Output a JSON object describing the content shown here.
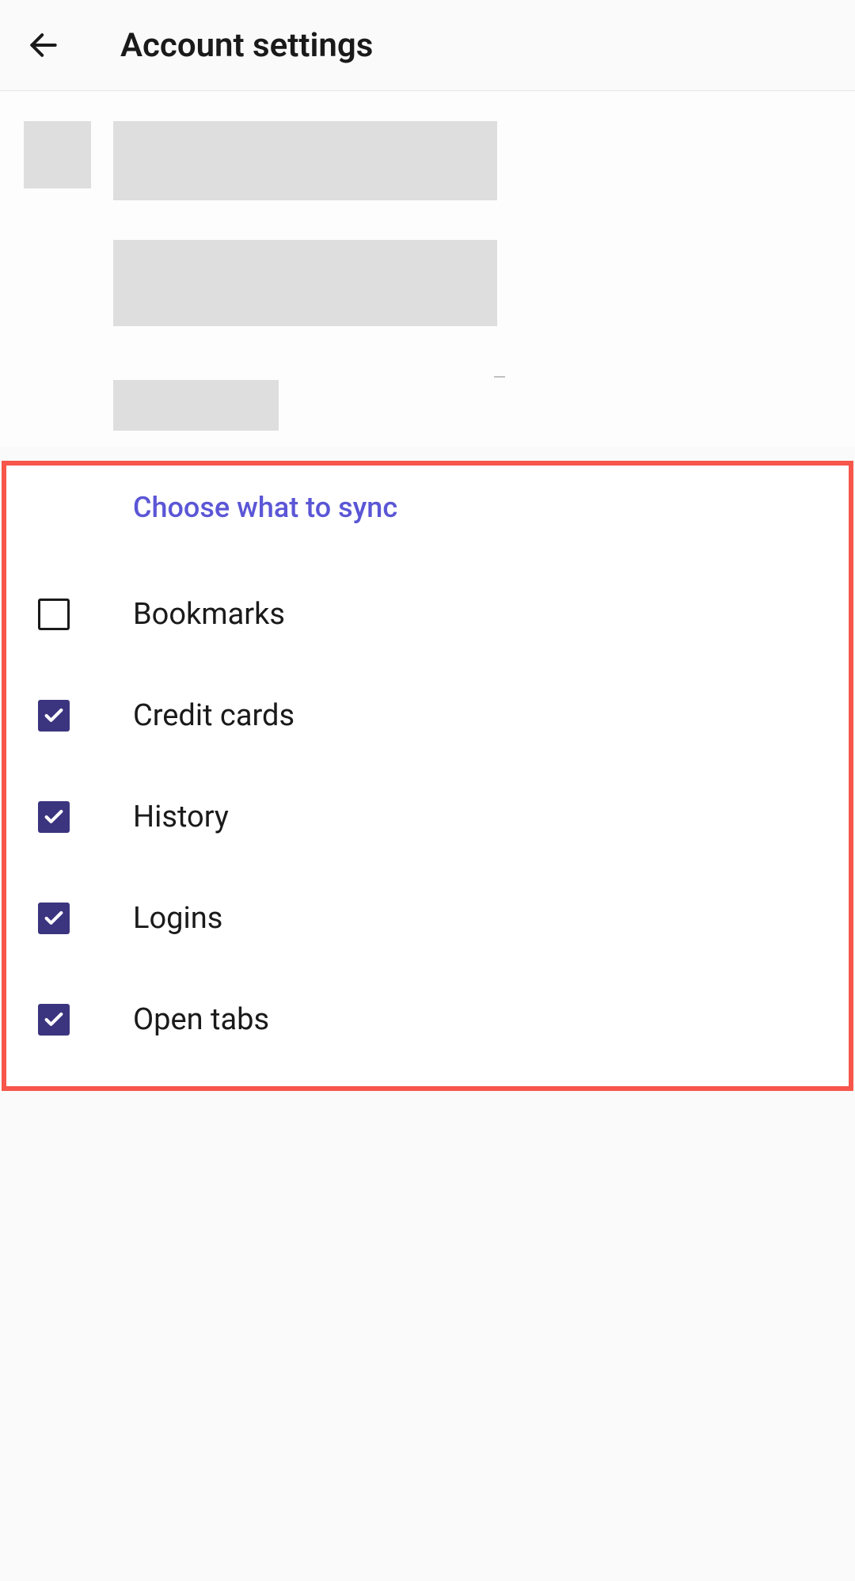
{
  "header": {
    "title": "Account settings"
  },
  "sync": {
    "section_title": "Choose what to sync",
    "items": [
      {
        "label": "Bookmarks",
        "checked": false
      },
      {
        "label": "Credit cards",
        "checked": true
      },
      {
        "label": "History",
        "checked": true
      },
      {
        "label": "Logins",
        "checked": true
      },
      {
        "label": "Open tabs",
        "checked": true
      }
    ]
  },
  "colors": {
    "accent": "#5b56d6",
    "checkbox_fill": "#3b357f",
    "highlight_border": "#f7564a"
  }
}
